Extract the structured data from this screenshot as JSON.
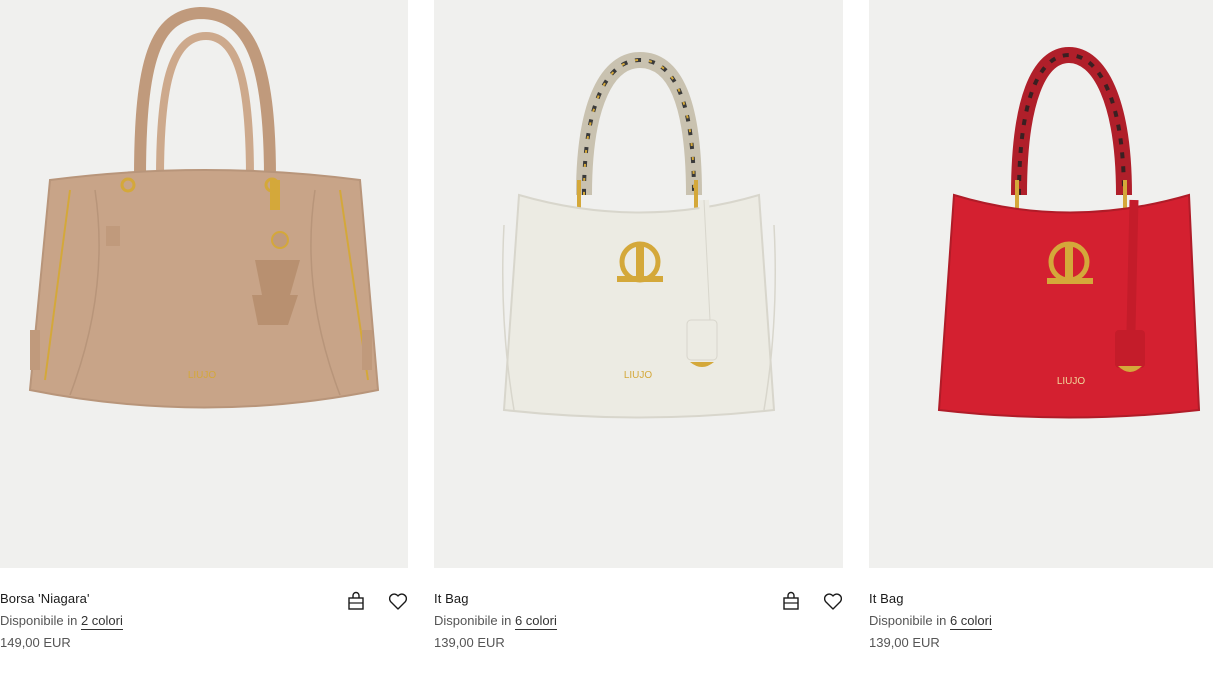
{
  "products": [
    {
      "name": "Borsa 'Niagara'",
      "availability_prefix": "Disponibile in",
      "colors_link": "2 colori",
      "price": "149,00 EUR",
      "bag_color": "#c8a488",
      "has_actions": true,
      "logo_text": "LIUJO"
    },
    {
      "name": "It Bag",
      "availability_prefix": "Disponibile in",
      "colors_link": "6 colori",
      "price": "139,00 EUR",
      "bag_color": "#ecebe3",
      "has_actions": true,
      "logo_text": "LIUJO"
    },
    {
      "name": "It Bag",
      "availability_prefix": "Disponibile in",
      "colors_link": "6 colori",
      "price": "139,00 EUR",
      "bag_color": "#d42030",
      "has_actions": false,
      "logo_text": "LIUJO"
    }
  ],
  "icons": {
    "cart": "shopping-bag-icon",
    "wishlist": "heart-icon"
  },
  "colors": {
    "image_background": "#f0f0ee",
    "gold": "#d4a83a"
  }
}
